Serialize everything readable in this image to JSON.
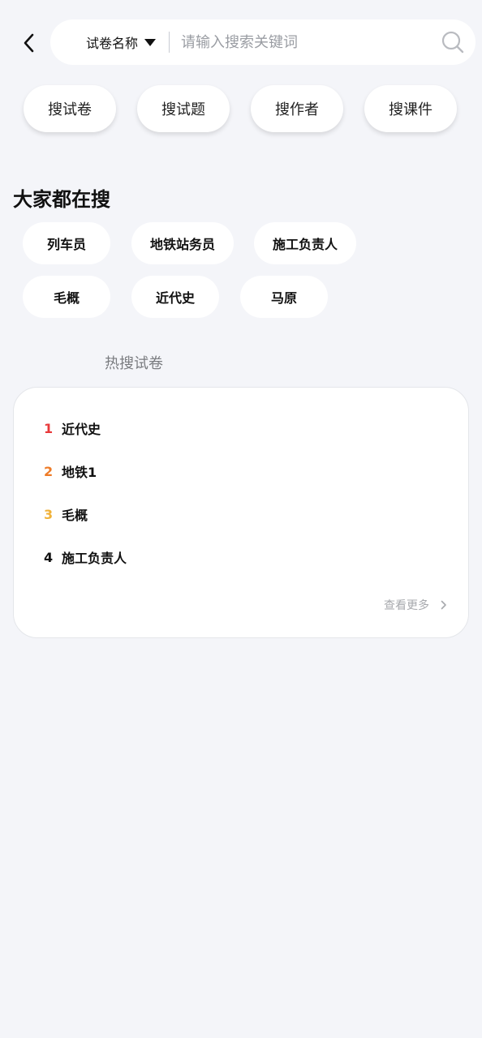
{
  "header": {
    "scope_label": "试卷名称",
    "search_placeholder": "请输入搜索关键词"
  },
  "categories": [
    {
      "label": "搜试卷"
    },
    {
      "label": "搜试题"
    },
    {
      "label": "搜作者"
    },
    {
      "label": "搜课件"
    }
  ],
  "trending": {
    "title": "大家都在搜",
    "tags": [
      {
        "label": "列车员"
      },
      {
        "label": "地铁站务员"
      },
      {
        "label": "施工负责人"
      },
      {
        "label": "毛概"
      },
      {
        "label": "近代史"
      },
      {
        "label": "马原"
      }
    ]
  },
  "hot": {
    "title": "热搜试卷",
    "items": [
      {
        "rank": "1",
        "name": "近代史",
        "color": "#e8393a"
      },
      {
        "rank": "2",
        "name": "地铁1",
        "color": "#ee7b27"
      },
      {
        "rank": "3",
        "name": "毛概",
        "color": "#f0b23a"
      },
      {
        "rank": "4",
        "name": "施工负责人",
        "color": "#111111"
      }
    ],
    "more_label": "查看更多"
  },
  "colors": {
    "background": "#f4f5f9",
    "rank1": "#e8393a",
    "rank2": "#ee7b27",
    "rank3": "#f0b23a"
  },
  "icons": [
    "back-arrow-icon",
    "caret-down-icon",
    "search-icon",
    "chevron-right-icon"
  ]
}
